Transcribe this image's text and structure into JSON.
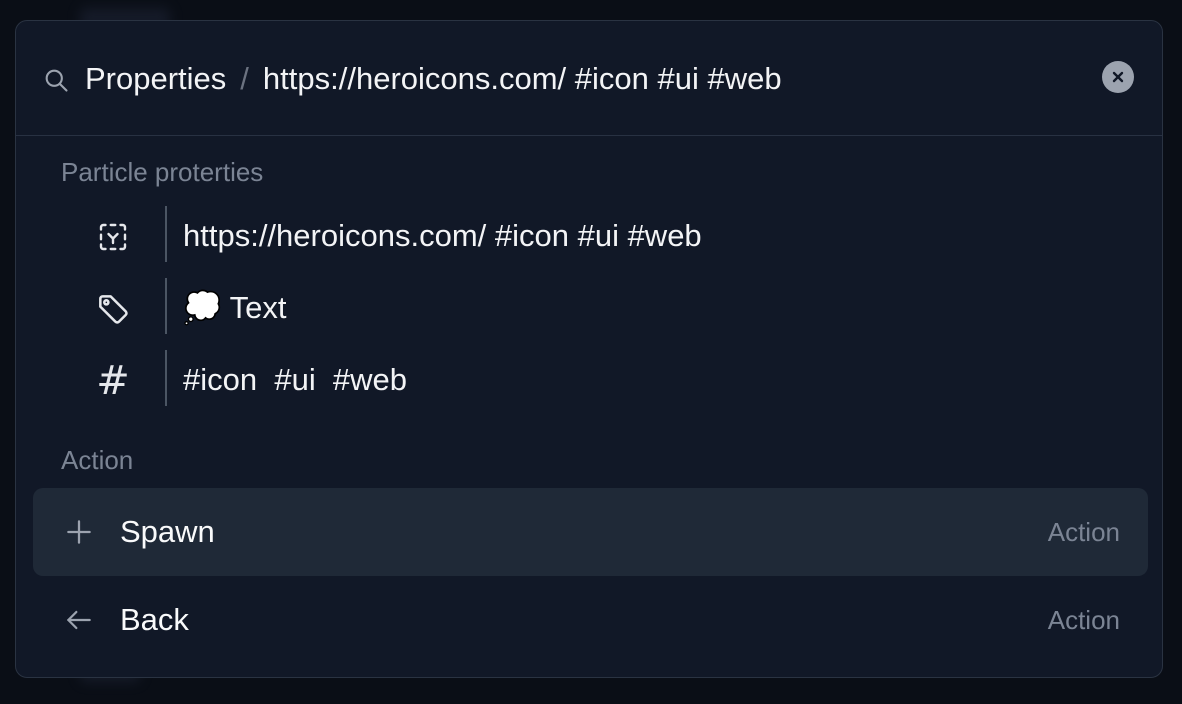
{
  "search": {
    "crumb_parent": "Properties",
    "crumb_separator": "/",
    "query": "https://heroicons.com/ #icon #ui #web",
    "icon": "search-icon",
    "clear_icon": "close-icon"
  },
  "properties_section": {
    "title": "Particle proterties",
    "items": [
      {
        "icon": "viewfinder-icon",
        "value": "https://heroicons.com/ #icon #ui #web"
      },
      {
        "icon": "tag-icon",
        "emoji": "💭",
        "value": "Text"
      },
      {
        "icon": "hash-icon",
        "glyph": "#",
        "value": "#icon  #ui  #web"
      }
    ]
  },
  "actions_section": {
    "title": "Action",
    "items": [
      {
        "label": "Spawn",
        "hint": "Action",
        "icon": "plus-icon",
        "active": true
      },
      {
        "label": "Back",
        "hint": "Action",
        "icon": "arrow-left-icon",
        "active": false
      }
    ]
  },
  "colors": {
    "panel": "#111827",
    "active_row": "#1f2937",
    "muted_text": "#7b8494",
    "primary_text": "#f3f4f6"
  }
}
